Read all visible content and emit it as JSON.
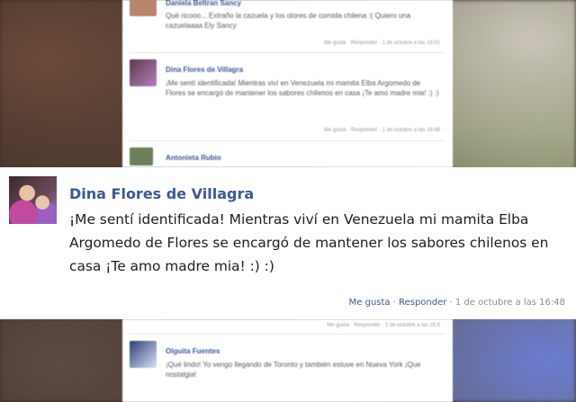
{
  "blurred_comments_top": [
    {
      "name": "Daniela Beltran Sancy",
      "text": "Qué ricooo... Extraño la cazuela y los olores de comida chilena :( Quiero una cazuelaaaa Ely Sancy",
      "meta": "Me gusta · Responder · 1 de octubre a las 16:01"
    },
    {
      "name": "Dina Flores de Villagra",
      "text": "¡Me sentí identificada! Mientras viví en Venezuela mi mamita Elba Argomedo de Flores se encargó de mantener los sabores chilenos en casa ¡Te amo madre mia! :) :)",
      "meta": "Me gusta · Responder · 1 de octubre a las 16:48"
    },
    {
      "name": "Antonieta Rubio",
      "text": "",
      "meta": ""
    }
  ],
  "featured_comment": {
    "name": "Dina Flores de Villagra",
    "text": "¡Me sentí identificada! Mientras viví en Venezuela mi mamita Elba Argomedo de Flores se encargó de mantener los sabores chilenos en casa ¡Te amo madre mia! :) :)",
    "like_label": "Me gusta",
    "separator": " · ",
    "reply_label": "Responder",
    "timestamp": " · 1 de octubre a las 16:48"
  },
  "blurred_comments_bottom": [
    {
      "name": "Olguita Fuentes",
      "text": "¡Qué lindo! Yo vengo llegando de Toronto y también estuve en Nueva York ¡Que nostalgia!",
      "meta": "Me gusta · Responder · 1 de octubre a las 16:5"
    }
  ],
  "colors": {
    "link": "#3b5998",
    "text": "#1d1d1d",
    "meta": "#8b8b8b"
  }
}
